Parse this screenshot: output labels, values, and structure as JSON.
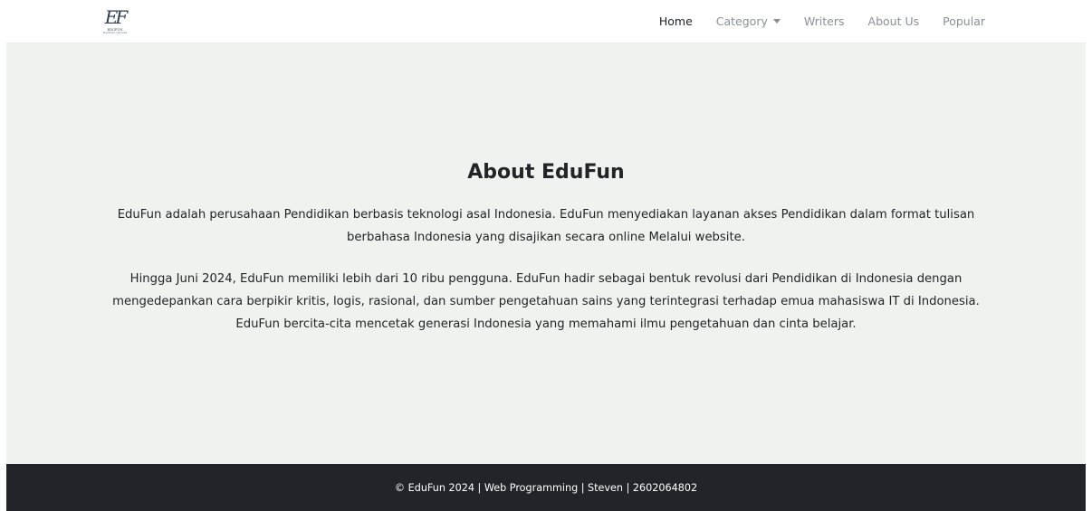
{
  "brand": {
    "mark": "EF",
    "text": "EDUFUN",
    "sub": "Pendidikan Indonesia"
  },
  "nav": {
    "items": [
      {
        "label": "Home",
        "active": true
      },
      {
        "label": "Category",
        "dropdown": true
      },
      {
        "label": "Writers"
      },
      {
        "label": "About Us"
      },
      {
        "label": "Popular"
      }
    ],
    "dropdown_icon": "caret-down-icon"
  },
  "main": {
    "title": "About EduFun",
    "paragraphs": [
      "EduFun adalah perusahaan Pendidikan berbasis teknologi asal Indonesia. EduFun menyediakan layanan akses Pendidikan dalam format tulisan berbahasa Indonesia yang disajikan secara online Melalui website.",
      "Hingga Juni 2024, EduFun memiliki lebih dari 10 ribu pengguna. EduFun hadir sebagai bentuk revolusi dari Pendidikan di Indonesia dengan mengedepankan cara berpikir kritis, logis, rasional, dan sumber pengetahuan sains yang terintegrasi terhadap emua mahasiswa IT di Indonesia. EduFun bercita-cita mencetak generasi Indonesia yang memahami ilmu pengetahuan dan cinta belajar."
    ]
  },
  "footer": {
    "text": "© EduFun 2024 | Web Programming | Steven | 2602064802"
  },
  "colors": {
    "main_bg": "#eff3ef",
    "footer_bg": "#212529",
    "nav_active": "#1d2125",
    "nav_inactive": "#8b9096"
  }
}
